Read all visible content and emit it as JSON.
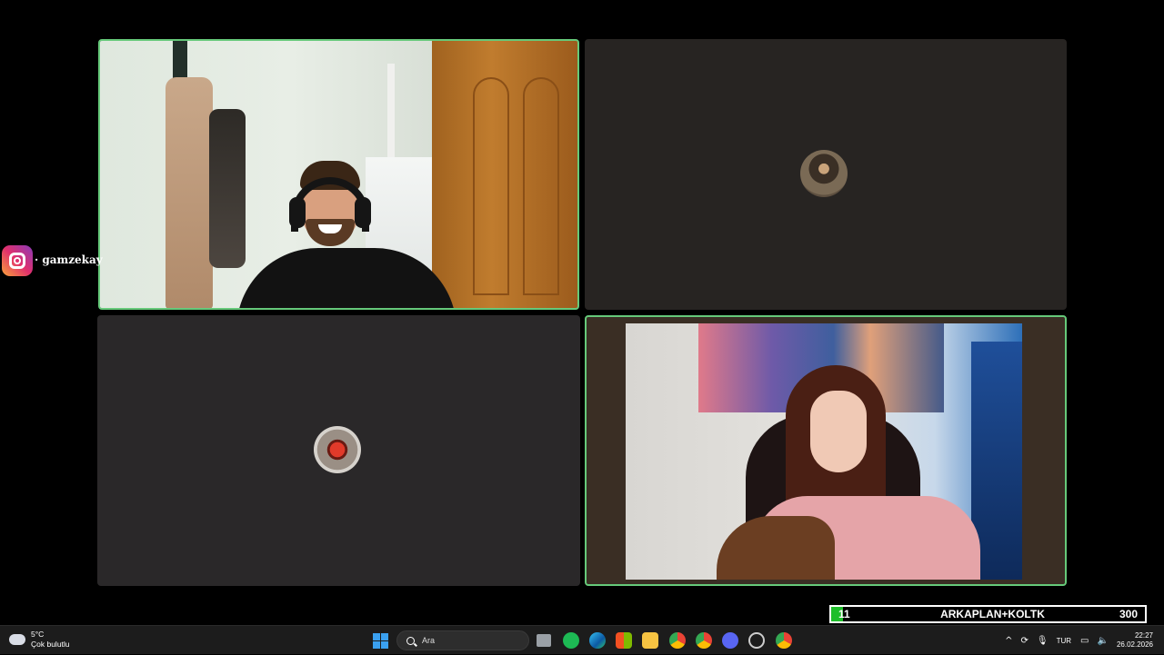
{
  "call": {
    "participants": [
      {
        "id": 1,
        "video": "on",
        "speaking": true
      },
      {
        "id": 2,
        "video": "off",
        "speaking": false
      },
      {
        "id": 3,
        "video": "off",
        "speaking": false
      },
      {
        "id": 4,
        "video": "on",
        "speaking": true
      }
    ]
  },
  "overlay": {
    "instagram_handle": "· gamzekay",
    "donation_goal": {
      "current": "11",
      "label": "ARKAPLAN+KOLTK",
      "target": "300",
      "progress_fraction": 0.037
    }
  },
  "taskbar": {
    "weather_temp": "5°C",
    "weather_desc": "Çok bulutlu",
    "search_placeholder": "Ara",
    "apps": [
      "task-view",
      "spotify",
      "edge",
      "store",
      "file-explorer",
      "chrome",
      "chrome-profile",
      "discord",
      "settings",
      "chrome-active"
    ],
    "language": "TUR",
    "time": "22:27",
    "date": "26.02.2026"
  },
  "colors": {
    "speaking_border": "#66c97a",
    "goal_fill": "#1ebe2a",
    "windows_blue": "#3aa0f0"
  }
}
